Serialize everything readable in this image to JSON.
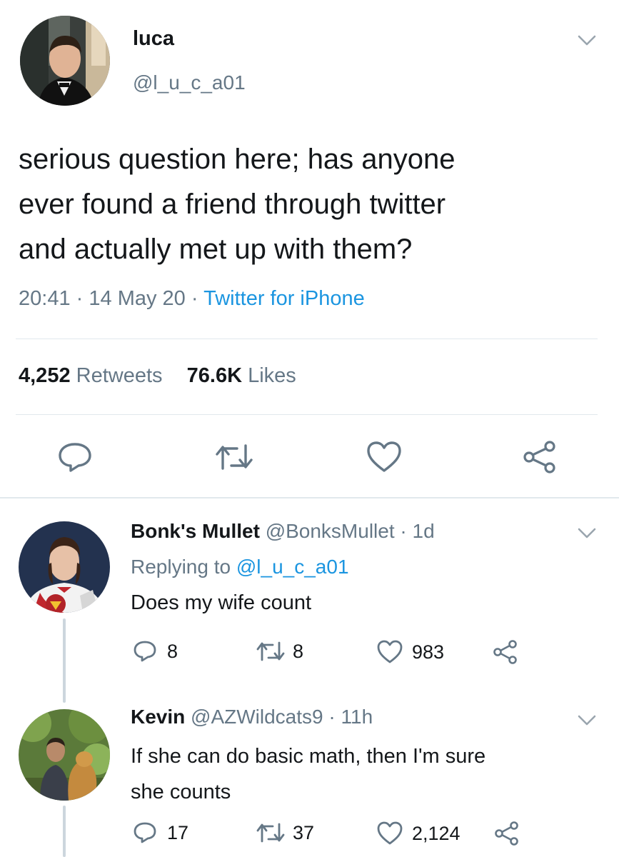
{
  "tweet": {
    "display_name": "luca",
    "handle": "@l_u_c_a01",
    "text_lines": [
      "serious question here; has anyone",
      "ever found a friend through twitter",
      "and actually met up with them?"
    ],
    "time": "20:41",
    "date": "14 May 20",
    "source": "Twitter for iPhone",
    "separator": "·",
    "retweets_count": "4,252",
    "retweets_label": "Retweets",
    "likes_count": "76.6K",
    "likes_label": "Likes"
  },
  "replies": [
    {
      "display_name": "Bonk's Mullet",
      "handle": "@BonksMullet",
      "age": "1d",
      "replying_to_prefix": "Replying to",
      "replying_to_handle": "@l_u_c_a01",
      "text_lines": [
        "Does my wife count"
      ],
      "reply_count": "8",
      "retweet_count": "8",
      "like_count": "983"
    },
    {
      "display_name": "Kevin",
      "handle": "@AZWildcats9",
      "age": "11h",
      "text_lines": [
        "If she can do basic math, then I'm sure",
        "she counts"
      ],
      "reply_count": "17",
      "retweet_count": "37",
      "like_count": "2,124"
    }
  ],
  "icons": {
    "reply": "reply-icon",
    "retweet": "retweet-icon",
    "like": "heart-icon",
    "share": "share-icon",
    "more": "chevron-down-icon"
  },
  "colors": {
    "text": "#14171a",
    "muted": "#657786",
    "link": "#1b95e0",
    "divider": "#e1e8ed"
  }
}
